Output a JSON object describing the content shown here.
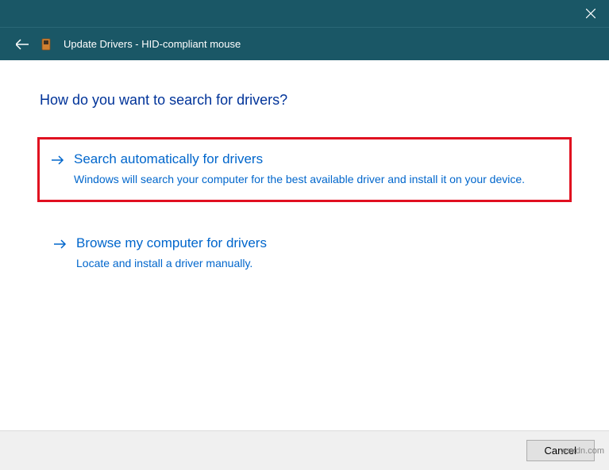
{
  "titlebar": {
    "close_label": "Close"
  },
  "header": {
    "title": "Update Drivers - HID-compliant mouse"
  },
  "content": {
    "heading": "How do you want to search for drivers?",
    "options": [
      {
        "title": "Search automatically for drivers",
        "description": "Windows will search your computer for the best available driver and install it on your device.",
        "highlighted": true
      },
      {
        "title": "Browse my computer for drivers",
        "description": "Locate and install a driver manually.",
        "highlighted": false
      }
    ]
  },
  "footer": {
    "cancel_label": "Cancel"
  },
  "watermark": "wsxdn.com"
}
